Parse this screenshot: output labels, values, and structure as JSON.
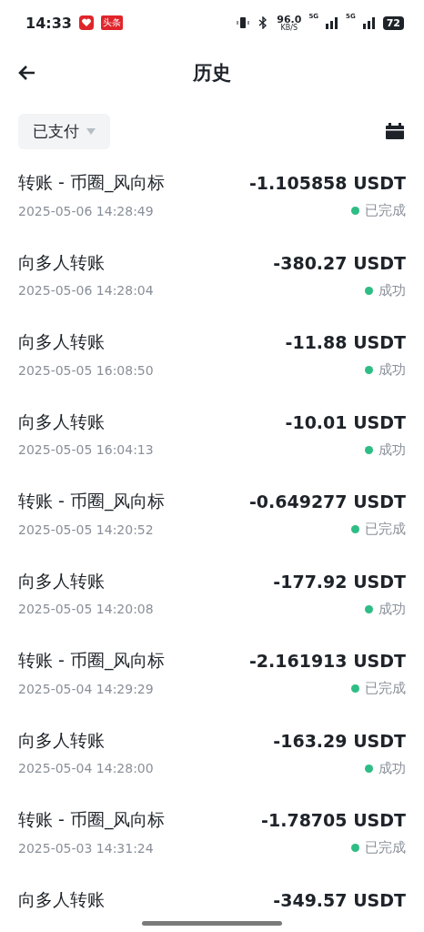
{
  "status_bar": {
    "time": "14:33",
    "news_badge": "头条",
    "speed": "96.0",
    "speed_unit": "KB/S",
    "network_1": "5G",
    "network_2": "5G",
    "battery": "72"
  },
  "header": {
    "title": "历史"
  },
  "filter": {
    "label": "已支付"
  },
  "transactions": [
    {
      "title": "转账 - 币圈_风向标",
      "amount": "-1.105858 USDT",
      "date": "2025-05-06 14:28:49",
      "status": "已完成"
    },
    {
      "title": "向多人转账",
      "amount": "-380.27 USDT",
      "date": "2025-05-06 14:28:04",
      "status": "成功"
    },
    {
      "title": "向多人转账",
      "amount": "-11.88 USDT",
      "date": "2025-05-05 16:08:50",
      "status": "成功"
    },
    {
      "title": "向多人转账",
      "amount": "-10.01 USDT",
      "date": "2025-05-05 16:04:13",
      "status": "成功"
    },
    {
      "title": "转账 - 币圈_风向标",
      "amount": "-0.649277 USDT",
      "date": "2025-05-05 14:20:52",
      "status": "已完成"
    },
    {
      "title": "向多人转账",
      "amount": "-177.92 USDT",
      "date": "2025-05-05 14:20:08",
      "status": "成功"
    },
    {
      "title": "转账 - 币圈_风向标",
      "amount": "-2.161913 USDT",
      "date": "2025-05-04 14:29:29",
      "status": "已完成"
    },
    {
      "title": "向多人转账",
      "amount": "-163.29 USDT",
      "date": "2025-05-04 14:28:00",
      "status": "成功"
    },
    {
      "title": "转账 - 币圈_风向标",
      "amount": "-1.78705 USDT",
      "date": "2025-05-03 14:31:24",
      "status": "已完成"
    },
    {
      "title": "向多人转账",
      "amount": "-349.57 USDT"
    }
  ]
}
